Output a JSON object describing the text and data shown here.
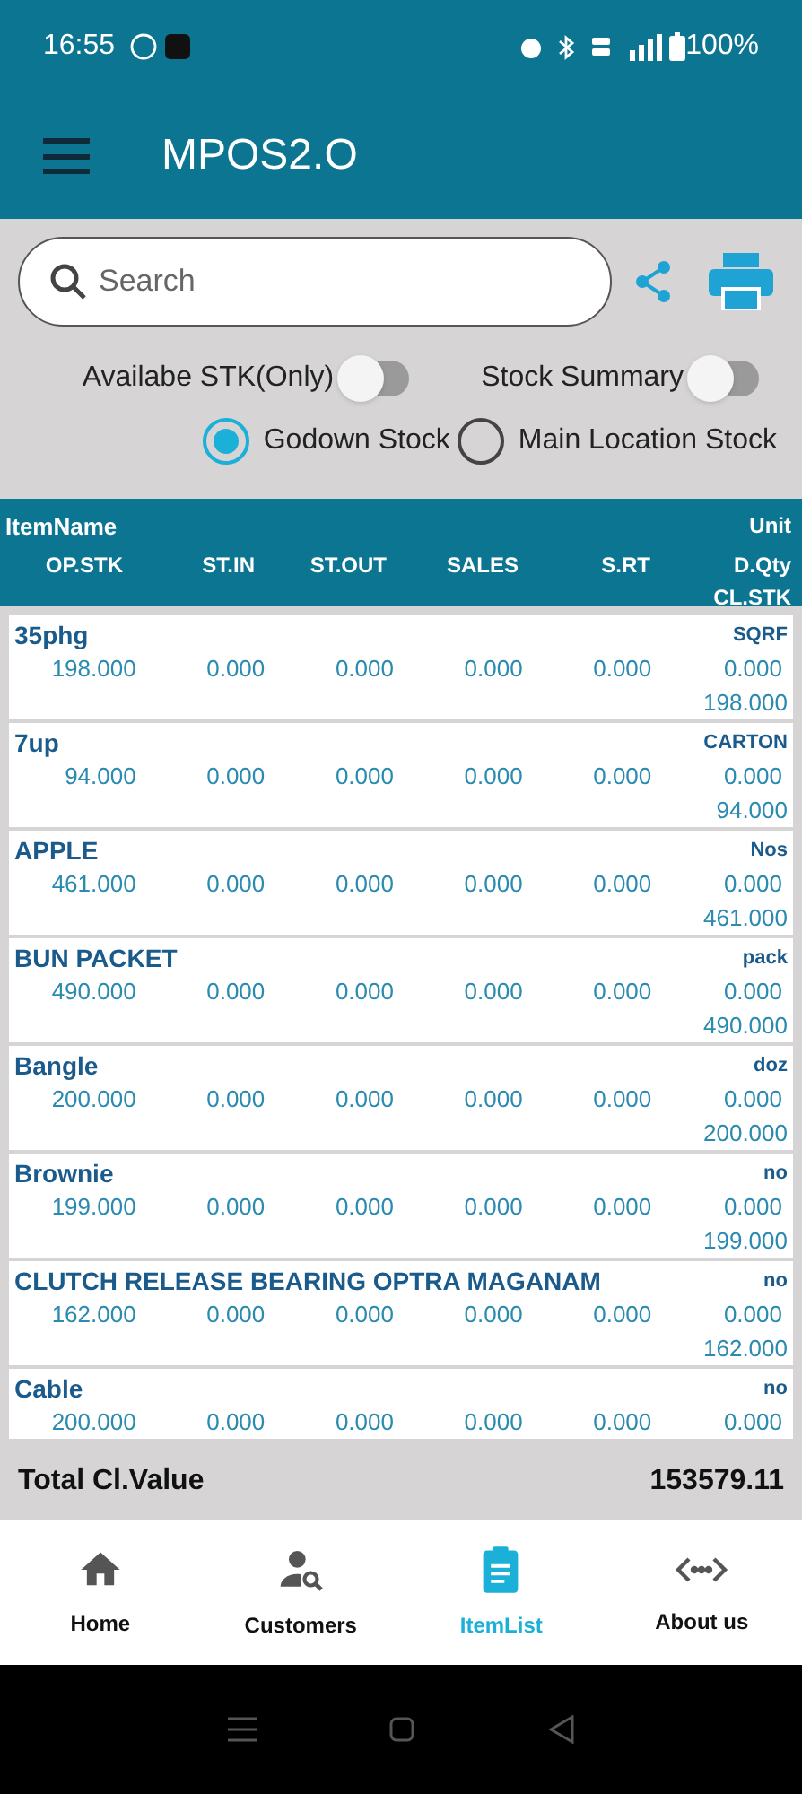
{
  "status_bar": {
    "time": "16:55",
    "battery": "100%"
  },
  "app_bar": {
    "title": "MPOS2.O"
  },
  "search": {
    "placeholder": "Search"
  },
  "toggles": [
    {
      "label": "Availabe STK(Only)",
      "on": false
    },
    {
      "label": "Stock Summary",
      "on": false
    }
  ],
  "stock_options": [
    {
      "label": "Godown Stock",
      "selected": true
    },
    {
      "label": "Main Location Stock",
      "selected": false
    }
  ],
  "table": {
    "columns": {
      "name": "ItemName",
      "unit": "Unit",
      "values": [
        "OP.STK",
        "ST.IN",
        "ST.OUT",
        "SALES",
        "S.RT",
        "D.Qty"
      ],
      "closing": "CL.STK"
    },
    "rows": [
      {
        "name": "35phg",
        "unit": "SQRF",
        "values": [
          "198.000",
          "0.000",
          "0.000",
          "0.000",
          "0.000",
          "0.000"
        ],
        "closing": "198.000"
      },
      {
        "name": "7up",
        "unit": "CARTON",
        "values": [
          "94.000",
          "0.000",
          "0.000",
          "0.000",
          "0.000",
          "0.000"
        ],
        "closing": "94.000"
      },
      {
        "name": "APPLE",
        "unit": "Nos",
        "values": [
          "461.000",
          "0.000",
          "0.000",
          "0.000",
          "0.000",
          "0.000"
        ],
        "closing": "461.000"
      },
      {
        "name": "BUN PACKET",
        "unit": "pack",
        "values": [
          "490.000",
          "0.000",
          "0.000",
          "0.000",
          "0.000",
          "0.000"
        ],
        "closing": "490.000"
      },
      {
        "name": "Bangle",
        "unit": "doz",
        "values": [
          "200.000",
          "0.000",
          "0.000",
          "0.000",
          "0.000",
          "0.000"
        ],
        "closing": "200.000"
      },
      {
        "name": "Brownie",
        "unit": "no",
        "values": [
          "199.000",
          "0.000",
          "0.000",
          "0.000",
          "0.000",
          "0.000"
        ],
        "closing": "199.000"
      },
      {
        "name": "CLUTCH RELEASE BEARING OPTRA  MAGANAM",
        "unit": "no",
        "values": [
          "162.000",
          "0.000",
          "0.000",
          "0.000",
          "0.000",
          "0.000"
        ],
        "closing": "162.000"
      },
      {
        "name": "Cable",
        "unit": "no",
        "values": [
          "200.000",
          "0.000",
          "0.000",
          "0.000",
          "0.000",
          "0.000"
        ]
      }
    ]
  },
  "total": {
    "label": "Total Cl.Value",
    "value": "153579.11"
  },
  "bottom_nav": [
    {
      "label": "Home",
      "selected": false
    },
    {
      "label": "Customers",
      "selected": false
    },
    {
      "label": "ItemList",
      "selected": true
    },
    {
      "label": "About us",
      "selected": false
    }
  ]
}
